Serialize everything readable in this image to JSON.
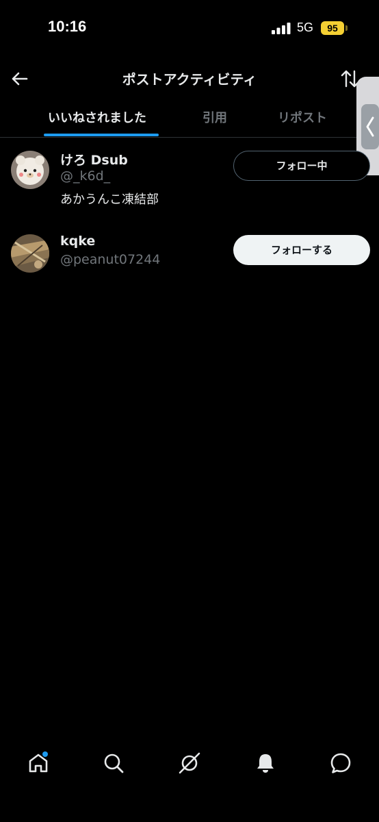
{
  "status_bar": {
    "time": "10:16",
    "network": "5G",
    "battery": "95",
    "battery_color": "#f5d033"
  },
  "header": {
    "title": "ポストアクティビティ",
    "back_icon": "arrow-left-icon",
    "sort_icon": "sort-arrows-icon"
  },
  "tabs": [
    {
      "label": "いいねされました",
      "active": true
    },
    {
      "label": "引用",
      "active": false
    },
    {
      "label": "リポスト",
      "active": false
    }
  ],
  "users": [
    {
      "name": "けろ Dsub",
      "handle": "@_k6d_",
      "bio": "あかうんこ凍結部",
      "button_label": "フォロー中",
      "following": true
    },
    {
      "name": "kqke",
      "handle": "@peanut07244",
      "bio": "",
      "button_label": "フォローする",
      "following": false
    }
  ],
  "bottom_nav": [
    {
      "icon": "home-icon",
      "has_badge": true
    },
    {
      "icon": "search-icon"
    },
    {
      "icon": "grok-icon"
    },
    {
      "icon": "bell-icon"
    },
    {
      "icon": "message-icon"
    }
  ],
  "colors": {
    "accent": "#1d9bf0",
    "background": "#000000",
    "muted_text": "#71767b"
  }
}
